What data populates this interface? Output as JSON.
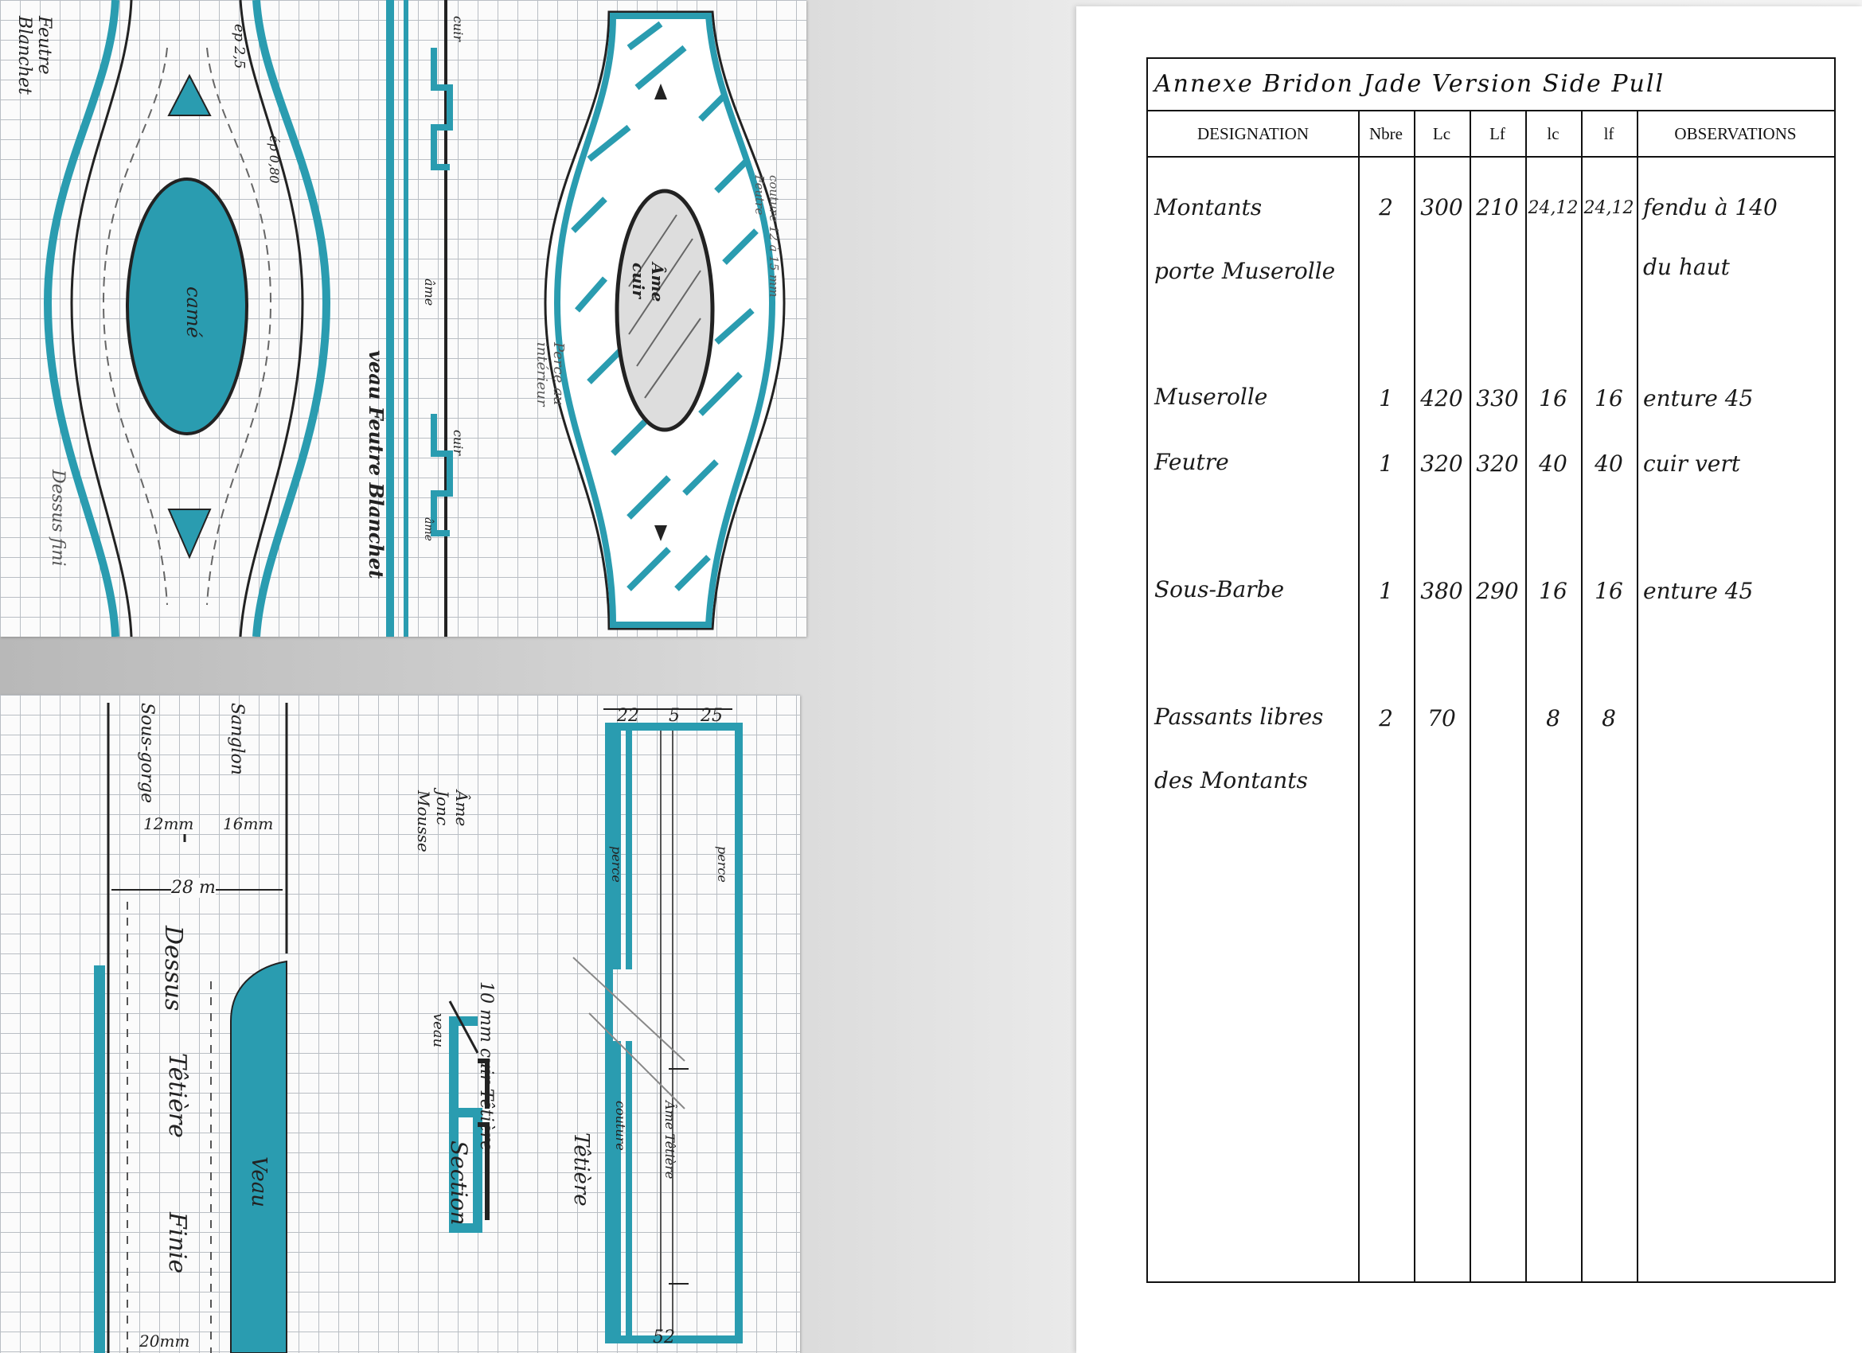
{
  "form": {
    "title": "Annexe Bridon Jade Version Side Pull",
    "headers": [
      "DESIGNATION",
      "Nbre",
      "Lc",
      "Lf",
      "lc",
      "lf",
      "OBSERVATIONS"
    ],
    "rows": [
      {
        "designation": [
          "Montants",
          "porte Muserolle"
        ],
        "nbre": "2",
        "lc": "300",
        "lf": "210",
        "lc2": "24,12",
        "lf2": "24,12",
        "observations": [
          "fendu à 140",
          "du haut"
        ]
      },
      {
        "designation": [
          "Muserolle"
        ],
        "nbre": "1",
        "lc": "420",
        "lf": "330",
        "lc2": "16",
        "lf2": "16",
        "observations": [
          "enture 45"
        ]
      },
      {
        "designation": [
          "Feutre"
        ],
        "nbre": "1",
        "lc": "320",
        "lf": "320",
        "lc2": "40",
        "lf2": "40",
        "observations": [
          "cuir vert"
        ]
      },
      {
        "designation": [
          "Sous-Barbe"
        ],
        "nbre": "1",
        "lc": "380",
        "lf": "290",
        "lc2": "16",
        "lf2": "16",
        "observations": [
          "enture 45"
        ]
      },
      {
        "designation": [
          "Passants libres",
          "des Montants"
        ],
        "nbre": "2",
        "lc": "70",
        "lf": "",
        "lc2": "8",
        "lf2": "8",
        "observations": []
      }
    ]
  },
  "sketch_top": {
    "left_labels": [
      "Feutre",
      "Blanchet"
    ],
    "dims": "ep 2,5",
    "dims2": "ép 0,80",
    "center": "camé",
    "side": "Dessus fini",
    "strip_labels": [
      "cuir",
      "âme",
      "cuir",
      "âme"
    ],
    "strip_side": "veau Feutre Blanchet",
    "right_center": [
      "Âme",
      "cuir"
    ],
    "right_side": [
      "couture 12 à 15 mm",
      "Feutre"
    ],
    "right_side2": [
      "Perce au",
      "intérieur"
    ]
  },
  "sketch_bottom": {
    "labels_top": [
      "Sous-gorge",
      "Sanglon"
    ],
    "sizes": [
      "12mm",
      "16mm"
    ],
    "width": "28 m",
    "vertical_text": [
      "Dessus",
      "Têtière",
      "Finie"
    ],
    "veau": "Veau",
    "bottom_dim": "20mm",
    "section_labels": [
      "Âme",
      "Jonc",
      "Mousse"
    ],
    "section_side": [
      "10 mm cuir Têtière",
      "Section"
    ],
    "veau_small": "veau",
    "dims_right": [
      "22",
      "5",
      "25"
    ],
    "right_labels": [
      "perce",
      "perce",
      "couture",
      "Âme Têtière",
      "Têtière"
    ],
    "bottom_right": "52"
  },
  "colors": {
    "teal": "#2a9cb0",
    "ink": "#1a1a1a"
  }
}
